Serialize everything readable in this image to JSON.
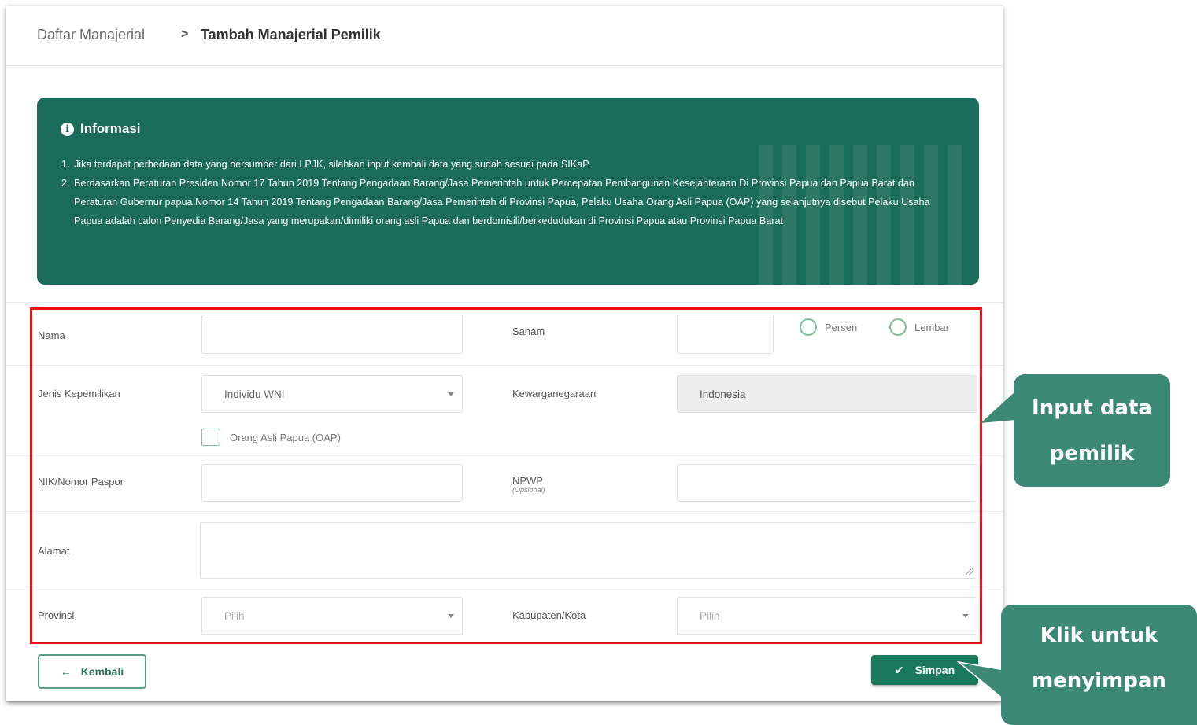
{
  "breadcrumb": {
    "parent": "Daftar Manajerial",
    "separator": ">",
    "current": "Tambah Manajerial Pemilik"
  },
  "info": {
    "icon": "info-icon",
    "title": "Informasi",
    "items": [
      {
        "num": "1.",
        "text": "Jika terdapat perbedaan data yang bersumber dari LPJK, silahkan input kembali data yang sudah sesuai pada SIKaP."
      },
      {
        "num": "2.",
        "text": "Berdasarkan Peraturan Presiden Nomor 17 Tahun 2019 Tentang Pengadaan Barang/Jasa Pemerintah untuk Percepatan Pembangunan Kesejahteraan Di Provinsi Papua dan Papua Barat dan Peraturan Gubernur papua Nomor 14 Tahun 2019 Tentang Pengadaan Barang/Jasa Pemerintah di Provinsi Papua, Pelaku Usaha Orang Asli Papua (OAP) yang selanjutnya disebut Pelaku Usaha Papua adalah calon Penyedia Barang/Jasa yang merupakan/dimiliki orang asli Papua dan berdomisili/berkedudukan di Provinsi Papua atau Provinsi Papua Barat"
      }
    ],
    "bg_color": "#1b6b5a"
  },
  "form": {
    "nama": {
      "label": "Nama",
      "value": ""
    },
    "saham": {
      "label": "Saham",
      "value": "",
      "options": [
        "Persen",
        "Lembar"
      ]
    },
    "jenis": {
      "label": "Jenis Kepemilikan",
      "value": "Individu WNI"
    },
    "oap": {
      "label": "Orang Asli Papua (OAP)",
      "checked": false
    },
    "kewarganegaraan": {
      "label": "Kewarganegaraan",
      "value": "Indonesia"
    },
    "nik": {
      "label": "NIK/Nomor Paspor",
      "value": ""
    },
    "npwp": {
      "label": "NPWP",
      "sublabel": "(Opsional)",
      "value": ""
    },
    "alamat": {
      "label": "Alamat",
      "value": ""
    },
    "provinsi": {
      "label": "Provinsi",
      "value": "Pilih"
    },
    "kabupaten": {
      "label": "Kabupaten/Kota",
      "value": "Pilih"
    }
  },
  "buttons": {
    "back": {
      "icon": "arrow-left-icon",
      "label": "Kembali"
    },
    "save": {
      "icon": "check-icon",
      "label": "Simpan"
    }
  },
  "callouts": {
    "input": [
      "Input data",
      "pemilik"
    ],
    "save": [
      "Klik untuk",
      "menyimpan"
    ]
  },
  "colors": {
    "highlight": "#ee1111",
    "callout": "#3c8a76",
    "primary": "#1b7a5c"
  }
}
